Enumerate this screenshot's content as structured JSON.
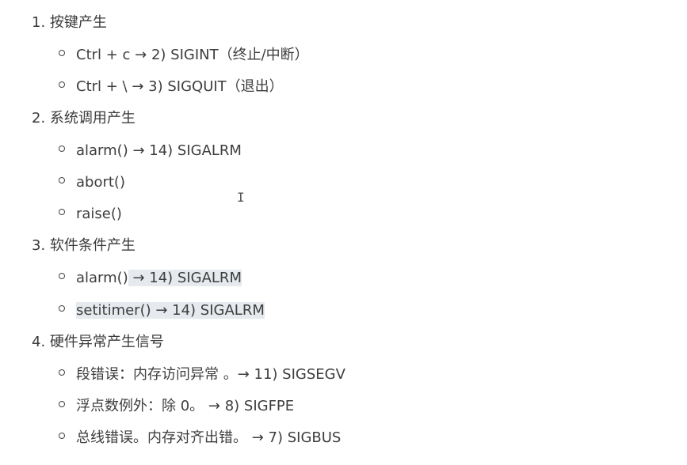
{
  "sections": [
    {
      "title": "1. 按键产生",
      "items": [
        {
          "text": "Ctrl + c  → 2) SIGINT（终止/中断）"
        },
        {
          "text": "Ctrl + \\  → 3) SIGQUIT（退出）"
        }
      ]
    },
    {
      "title": "2. 系统调用产生",
      "items": [
        {
          "text": "alarm() → 14) SIGALRM"
        },
        {
          "text": "abort()"
        },
        {
          "text": "raise()"
        }
      ]
    },
    {
      "title": "3. 软件条件产生",
      "items": [
        {
          "plain": "alarm()",
          "highlight": " → 14) SIGALRM "
        },
        {
          "plain": "",
          "highlight": "setitimer() → 14) SIGALRM"
        }
      ]
    },
    {
      "title": "4. 硬件异常产生信号",
      "items": [
        {
          "text": "段错误：内存访问异常 。→  11) SIGSEGV"
        },
        {
          "text": "浮点数例外：除 0。 → 8) SIGFPE"
        },
        {
          "text": "总线错误。内存对齐出错。 → 7) SIGBUS"
        }
      ]
    }
  ],
  "cursor": {
    "icon": "text-cursor-icon",
    "glyph": "I"
  }
}
